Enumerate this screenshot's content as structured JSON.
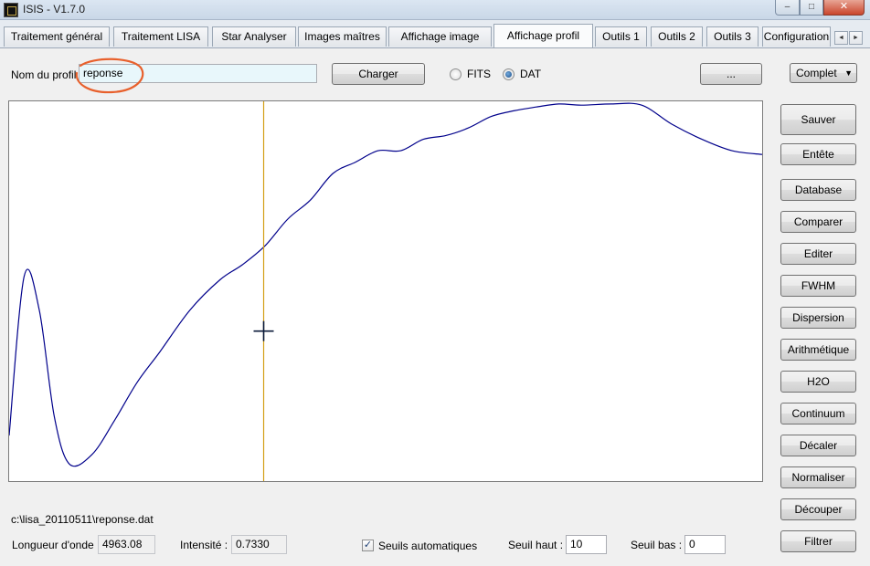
{
  "window": {
    "title": "ISIS - V1.7.0",
    "icon": "isis-app-icon",
    "controls": {
      "minimize": "–",
      "maximize": "□",
      "close": "✕"
    }
  },
  "tabs": [
    {
      "label": "Traitement général"
    },
    {
      "label": "Traitement LISA"
    },
    {
      "label": "Star Analyser"
    },
    {
      "label": "Images maîtres"
    },
    {
      "label": "Affichage image"
    },
    {
      "label": "Affichage profil",
      "active": true
    },
    {
      "label": "Outils 1"
    },
    {
      "label": "Outils 2"
    },
    {
      "label": "Outils 3"
    },
    {
      "label": "Configuration"
    }
  ],
  "tab_scroll": {
    "left": "◄",
    "right": "►"
  },
  "profile": {
    "name_label": "Nom du profil :",
    "name_value": "reponse",
    "load_button": "Charger",
    "format_options": [
      {
        "label": "FITS",
        "checked": false
      },
      {
        "label": "DAT",
        "checked": true
      }
    ],
    "browse_button": "...",
    "mode_select": "Complet"
  },
  "side_buttons": [
    "Sauver",
    "Entête",
    "Database",
    "Comparer",
    "Editer",
    "FWHM",
    "Dispersion",
    "Arithmétique",
    "H2O",
    "Continuum",
    "Décaler",
    "Normaliser",
    "Découper",
    "Filtrer"
  ],
  "status": {
    "file_path": "c:\\lisa_20110511\\reponse.dat",
    "wavelength_label": "Longueur d'onde :",
    "wavelength_value": "4963.08",
    "intensity_label": "Intensité :",
    "intensity_value": "0.7330",
    "auto_threshold_label": "Seuils automatiques",
    "auto_threshold_checked": true,
    "high_threshold_label": "Seuil haut :",
    "high_threshold_value": "10",
    "low_threshold_label": "Seuil bas :",
    "low_threshold_value": "0"
  },
  "colors": {
    "curve": "#00008b",
    "cursor_line": "#d4a017",
    "crosshair": "#0b1a3a",
    "annotation_circle": "#e8602c"
  },
  "chart_data": {
    "type": "line",
    "title": "",
    "xlabel": "",
    "ylabel": "",
    "grid": false,
    "x": [
      0,
      0.02,
      0.04,
      0.06,
      0.08,
      0.11,
      0.14,
      0.17,
      0.2,
      0.24,
      0.28,
      0.31,
      0.34,
      0.37,
      0.4,
      0.43,
      0.46,
      0.49,
      0.52,
      0.55,
      0.58,
      0.61,
      0.64,
      0.67,
      0.7,
      0.73,
      0.76,
      0.8,
      0.84,
      0.88,
      0.92,
      0.96,
      1.0
    ],
    "y": [
      0.12,
      0.54,
      0.45,
      0.17,
      0.045,
      0.07,
      0.16,
      0.26,
      0.34,
      0.45,
      0.53,
      0.57,
      0.62,
      0.69,
      0.74,
      0.81,
      0.84,
      0.87,
      0.87,
      0.9,
      0.91,
      0.93,
      0.96,
      0.975,
      0.985,
      0.993,
      0.99,
      0.993,
      0.99,
      0.94,
      0.9,
      0.87,
      0.86
    ],
    "cursor": {
      "x": 0.338,
      "y": 0.395
    }
  }
}
